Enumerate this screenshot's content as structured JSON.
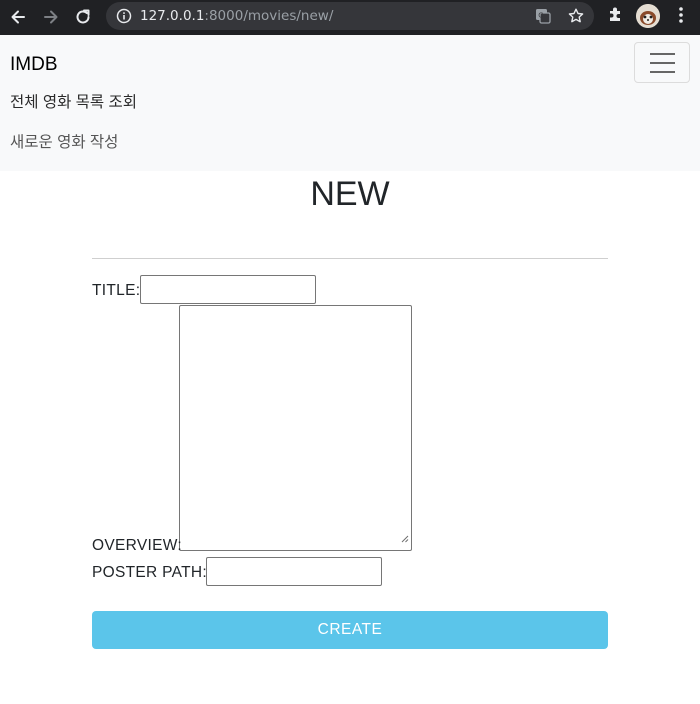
{
  "browser": {
    "url_host": "127.0.0.1",
    "url_rest": ":8000/movies/new/"
  },
  "navbar": {
    "brand": "IMDB",
    "links": [
      "전체 영화 목록 조회",
      "새로운 영화 작성"
    ]
  },
  "page": {
    "title": "NEW"
  },
  "form": {
    "title_label": "TITLE:",
    "overview_label": "OVERVIEW:",
    "poster_label": "POSTER PATH:",
    "title_value": "",
    "overview_value": "",
    "poster_value": "",
    "submit_label": "CREATE"
  },
  "colors": {
    "chrome_bg": "#202124",
    "navbar_bg": "#f8f9fa",
    "button_bg": "#5bc5ea"
  }
}
